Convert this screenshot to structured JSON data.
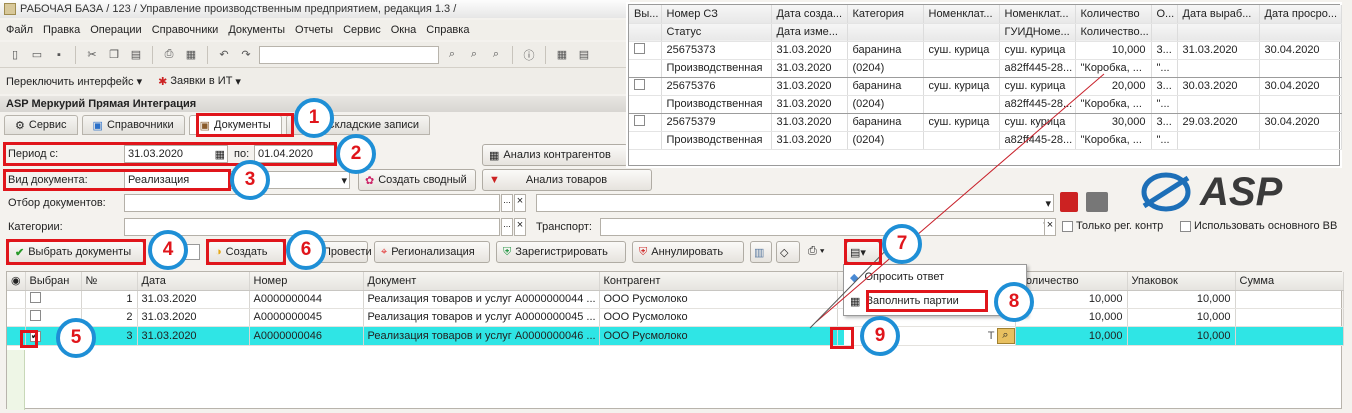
{
  "window": {
    "title": "РАБОЧАЯ БАЗА / 123 / Управление производственным предприятием, редакция 1.3 /"
  },
  "menu": [
    "Файл",
    "Правка",
    "Операции",
    "Справочники",
    "Документы",
    "Отчеты",
    "Сервис",
    "Окна",
    "Справка"
  ],
  "toolbar2": {
    "switch_interface": "Переключить интерфейс",
    "it_requests": "Заявки в ИТ"
  },
  "app": {
    "title": "ASP Меркурий Прямая Интеграция"
  },
  "tabs": [
    "Сервис",
    "Справочники",
    "Документы",
    "Складские записи"
  ],
  "filters": {
    "period_label": "Период с:",
    "period_from": "31.03.2020",
    "period_to_label": "по:",
    "period_to": "01.04.2020",
    "doc_type_label": "Вид документа:",
    "doc_type": "Реализация",
    "doc_filter_label": "Отбор документов:",
    "categories_label": "Категории:",
    "transport_label": "Транспорт:",
    "only_reg_label": "Только рег. контр",
    "use_main_label": "Использовать основного ВВ"
  },
  "buttons": {
    "analysis_contractors": "Анализ контрагентов",
    "create_summary": "Создать сводный",
    "analysis_goods": "Анализ товаров",
    "select_docs": "Выбрать документы",
    "create": "Создать",
    "post": "Провести",
    "regionalization": "Регионализация",
    "register": "Зарегистрировать",
    "cancel": "Аннулировать"
  },
  "logo": {
    "text": "ASP"
  },
  "main_table": {
    "columns": [
      "Выбран",
      "№",
      "Дата",
      "Номер",
      "Документ",
      "Контрагент",
      "Количество",
      "Упаковок",
      "Сумма"
    ],
    "rows": [
      {
        "checked": false,
        "n": "1",
        "date": "31.03.2020",
        "number": "А0000000044",
        "doc": "Реализация товаров и услуг А0000000044 ...",
        "contractor": "ООО Русмолоко",
        "qty": "10,000",
        "pack": "10,000",
        "sum": ""
      },
      {
        "checked": false,
        "n": "2",
        "date": "31.03.2020",
        "number": "А0000000045",
        "doc": "Реализация товаров и услуг А0000000045 ...",
        "contractor": "ООО Русмолоко",
        "qty": "10,000",
        "pack": "10,000",
        "sum": ""
      },
      {
        "checked": true,
        "n": "3",
        "date": "31.03.2020",
        "number": "А0000000046",
        "doc": "Реализация товаров и услуг А0000000046 ...",
        "contractor": "ООО Русмолоко",
        "qty": "10,000",
        "pack": "10,000",
        "sum": ""
      }
    ]
  },
  "popup": {
    "items": [
      "Опросить ответ",
      "Заполнить партии"
    ]
  },
  "overlay_table": {
    "header1": [
      "Вы...",
      "Номер СЗ",
      "Дата созда...",
      "Категория",
      "Номенклат...",
      "Номенклат...",
      "Количество",
      "О...",
      "Дата выраб...",
      "Дата просро..."
    ],
    "header2": [
      "",
      "Статус",
      "Дата изме...",
      "",
      "",
      "ГУИДНоме...",
      "Количество...",
      "",
      "",
      ""
    ],
    "rows": [
      {
        "num": "25675373",
        "status": "Производственная",
        "date1": "31.03.2020",
        "date2": "31.03.2020",
        "cat1": "баранина",
        "cat2": "(0204)",
        "nom": "суш. курица",
        "nom2a": "суш. курица",
        "nom2b": "a82ff445-28...",
        "qty": "10,000",
        "qty2": "\"Коробка, ...",
        "o1": "3...",
        "o2": "\"...",
        "prod": "31.03.2020",
        "exp": "30.04.2020"
      },
      {
        "num": "25675376",
        "status": "Производственная",
        "date1": "31.03.2020",
        "date2": "31.03.2020",
        "cat1": "баранина",
        "cat2": "(0204)",
        "nom": "суш. курица",
        "nom2a": "суш. курица",
        "nom2b": "a82ff445-28...",
        "qty": "20,000",
        "qty2": "\"Коробка, ...",
        "o1": "3...",
        "o2": "\"...",
        "prod": "30.03.2020",
        "exp": "30.04.2020"
      },
      {
        "num": "25675379",
        "status": "Производственная",
        "date1": "31.03.2020",
        "date2": "31.03.2020",
        "cat1": "баранина",
        "cat2": "(0204)",
        "nom": "суш. курица",
        "nom2a": "суш. курица",
        "nom2b": "a82ff445-28...",
        "qty": "30,000",
        "qty2": "\"Коробка, ...",
        "o1": "3...",
        "o2": "\"...",
        "prod": "29.03.2020",
        "exp": "30.04.2020"
      }
    ]
  },
  "annotations": [
    "1",
    "2",
    "3",
    "4",
    "5",
    "6",
    "7",
    "8",
    "9"
  ],
  "colors": {
    "highlight_row": "#2fe5e5",
    "annotation_red": "#e0151b",
    "annotation_blue": "#1e8fd6"
  }
}
